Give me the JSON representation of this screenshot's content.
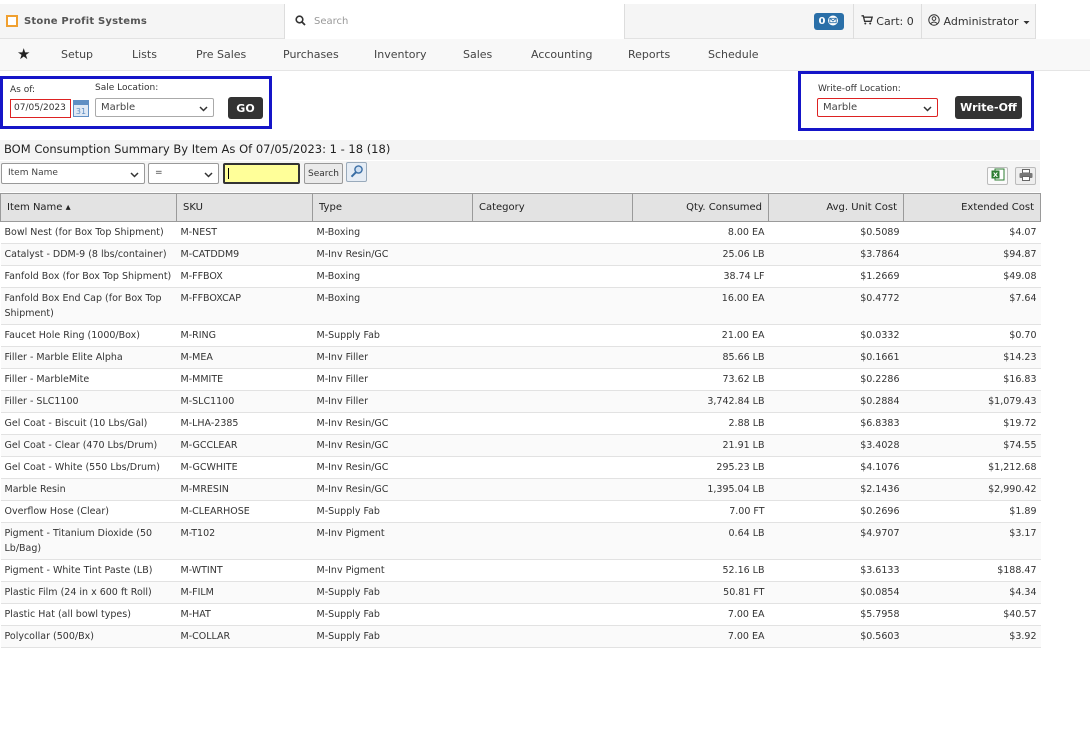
{
  "header": {
    "brand": "Stone Profit Systems",
    "search_placeholder": "Search",
    "messages_count": "0",
    "cart_label": "Cart: 0",
    "user_label": "Administrator"
  },
  "nav": [
    "Setup",
    "Lists",
    "Pre Sales",
    "Purchases",
    "Inventory",
    "Sales",
    "Accounting",
    "Reports",
    "Schedule"
  ],
  "filters": {
    "as_of_label": "As of:",
    "as_of_value": "07/05/2023",
    "calendar_day": "31",
    "sale_location_label": "Sale Location:",
    "sale_location_value": "Marble",
    "go_label": "GO",
    "writeoff_location_label": "Write-off Location:",
    "writeoff_location_value": "Marble",
    "writeoff_button": "Write-Off"
  },
  "report": {
    "title": "BOM Consumption Summary By Item As Of 07/05/2023: 1 - 18 (18)"
  },
  "toolbar": {
    "field_select": "Item Name",
    "operator_select": "=",
    "search_value": "",
    "search_button": "Search"
  },
  "table": {
    "columns": [
      "Item Name ▴",
      "SKU",
      "Type",
      "Category",
      "Qty. Consumed",
      "Avg. Unit Cost",
      "Extended Cost"
    ],
    "rows": [
      [
        "Bowl Nest (for Box Top Shipment)",
        "M-NEST",
        "M-Boxing",
        "",
        "8.00 EA",
        "$0.5089",
        "$4.07"
      ],
      [
        "Catalyst - DDM-9 (8 lbs/container)",
        "M-CATDDM9",
        "M-Inv Resin/GC",
        "",
        "25.06 LB",
        "$3.7864",
        "$94.87"
      ],
      [
        "Fanfold Box (for Box Top Shipment)",
        "M-FFBOX",
        "M-Boxing",
        "",
        "38.74 LF",
        "$1.2669",
        "$49.08"
      ],
      [
        "Fanfold Box End Cap (for Box Top Shipment)",
        "M-FFBOXCAP",
        "M-Boxing",
        "",
        "16.00 EA",
        "$0.4772",
        "$7.64"
      ],
      [
        "Faucet Hole Ring (1000/Box)",
        "M-RING",
        "M-Supply Fab",
        "",
        "21.00 EA",
        "$0.0332",
        "$0.70"
      ],
      [
        "Filler - Marble Elite Alpha",
        "M-MEA",
        "M-Inv Filler",
        "",
        "85.66 LB",
        "$0.1661",
        "$14.23"
      ],
      [
        "Filler - MarbleMite",
        "M-MMITE",
        "M-Inv Filler",
        "",
        "73.62 LB",
        "$0.2286",
        "$16.83"
      ],
      [
        "Filler - SLC1100",
        "M-SLC1100",
        "M-Inv Filler",
        "",
        "3,742.84 LB",
        "$0.2884",
        "$1,079.43"
      ],
      [
        "Gel Coat - Biscuit (10 Lbs/Gal)",
        "M-LHA-2385",
        "M-Inv Resin/GC",
        "",
        "2.88 LB",
        "$6.8383",
        "$19.72"
      ],
      [
        "Gel Coat - Clear (470 Lbs/Drum)",
        "M-GCCLEAR",
        "M-Inv Resin/GC",
        "",
        "21.91 LB",
        "$3.4028",
        "$74.55"
      ],
      [
        "Gel Coat - White (550 Lbs/Drum)",
        "M-GCWHITE",
        "M-Inv Resin/GC",
        "",
        "295.23 LB",
        "$4.1076",
        "$1,212.68"
      ],
      [
        "Marble Resin",
        "M-MRESIN",
        "M-Inv Resin/GC",
        "",
        "1,395.04 LB",
        "$2.1436",
        "$2,990.42"
      ],
      [
        "Overflow Hose (Clear)",
        "M-CLEARHOSE",
        "M-Supply Fab",
        "",
        "7.00 FT",
        "$0.2696",
        "$1.89"
      ],
      [
        "Pigment - Titanium Dioxide (50 Lb/Bag)",
        "M-T102",
        "M-Inv Pigment",
        "",
        "0.64 LB",
        "$4.9707",
        "$3.17"
      ],
      [
        "Pigment - White Tint Paste (LB)",
        "M-WTINT",
        "M-Inv Pigment",
        "",
        "52.16 LB",
        "$3.6133",
        "$188.47"
      ],
      [
        "Plastic Film (24 in x 600 ft Roll)",
        "M-FILM",
        "M-Supply Fab",
        "",
        "50.81 FT",
        "$0.0854",
        "$4.34"
      ],
      [
        "Plastic Hat (all bowl types)",
        "M-HAT",
        "M-Supply Fab",
        "",
        "7.00 EA",
        "$5.7958",
        "$40.57"
      ],
      [
        "Polycollar (500/Bx)",
        "M-COLLAR",
        "M-Supply Fab",
        "",
        "7.00 EA",
        "$0.5603",
        "$3.92"
      ]
    ]
  }
}
